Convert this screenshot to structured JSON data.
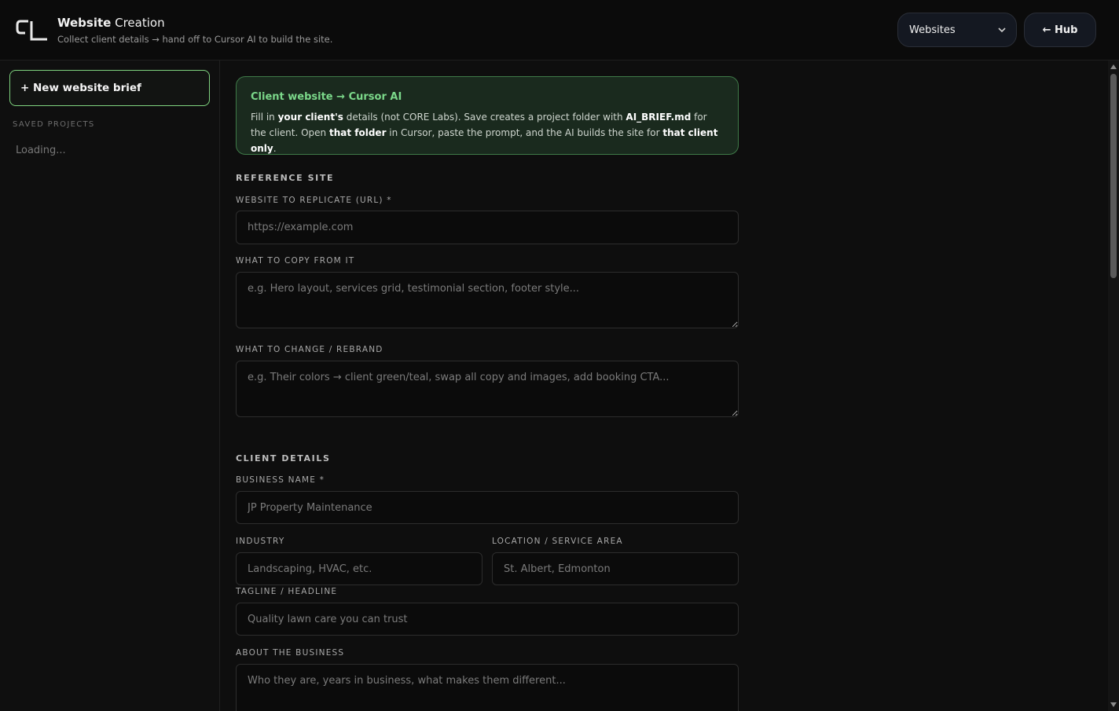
{
  "header": {
    "title_bold": "Website",
    "title_rest": " Creation",
    "subtitle": "Collect client details → hand off to Cursor AI to build the site.",
    "mode_select": "Websites",
    "hub_button": "← Hub"
  },
  "sidebar": {
    "new_brief": "+ New website brief",
    "saved_label": "SAVED PROJECTS",
    "loading": "Loading..."
  },
  "info": {
    "title": "Client website → Cursor AI",
    "p1": "Fill in ",
    "b1": "your client's",
    "p2": " details (not CORE Labs). Save creates a project folder with ",
    "b2": "AI_BRIEF.md",
    "p3": " for the client. Open ",
    "b3": "that folder",
    "p4": " in Cursor, paste the prompt, and the AI builds the site for ",
    "b4": "that client only",
    "p5": "."
  },
  "reference": {
    "section": "REFERENCE SITE",
    "url_label": "WEBSITE TO REPLICATE (URL) *",
    "url_placeholder": "https://example.com",
    "copy_label": "WHAT TO COPY FROM IT",
    "copy_placeholder": "e.g. Hero layout, services grid, testimonial section, footer style...",
    "change_label": "WHAT TO CHANGE / REBRAND",
    "change_placeholder": "e.g. Their colors → client green/teal, swap all copy and images, add booking CTA..."
  },
  "client": {
    "section": "CLIENT DETAILS",
    "business_label": "BUSINESS NAME *",
    "business_placeholder": "JP Property Maintenance",
    "industry_label": "INDUSTRY",
    "industry_placeholder": "Landscaping, HVAC, etc.",
    "location_label": "LOCATION / SERVICE AREA",
    "location_placeholder": "St. Albert, Edmonton",
    "tagline_label": "TAGLINE / HEADLINE",
    "tagline_placeholder": "Quality lawn care you can trust",
    "about_label": "ABOUT THE BUSINESS",
    "about_placeholder": "Who they are, years in business, what makes them different..."
  },
  "colors": {
    "accent_green": "#7bd88a",
    "info_bg": "#1a2a1e",
    "border": "#2d2d2d"
  }
}
